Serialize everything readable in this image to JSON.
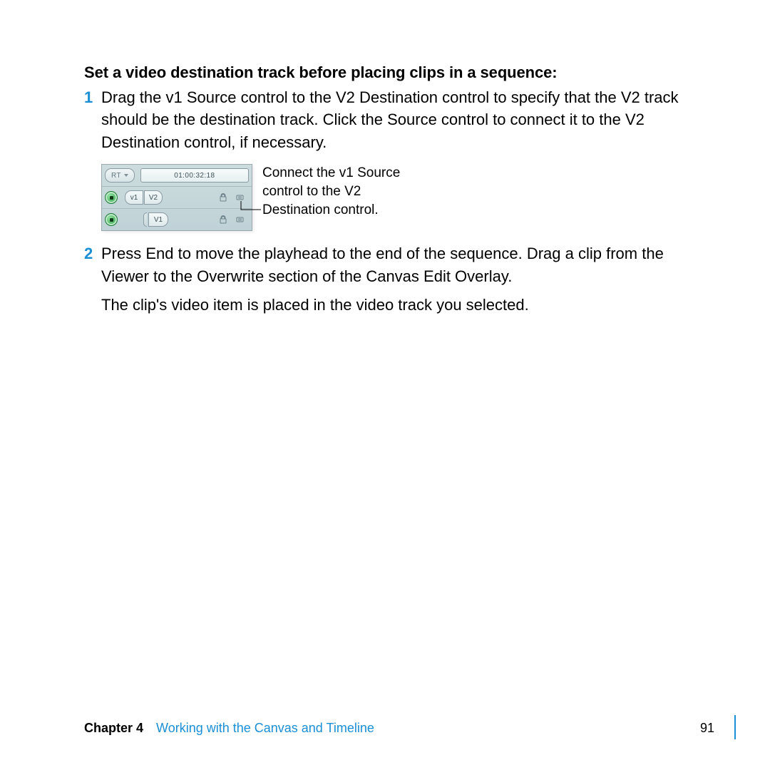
{
  "heading": "Set a video destination track before placing clips in a sequence:",
  "steps": [
    {
      "num": "1",
      "text": "Drag the v1 Source control to the V2 Destination control to specify that the V2 track should be the destination track. Click the Source control to connect it to the V2 Destination control, if necessary."
    },
    {
      "num": "2",
      "text": "Press End to move the playhead to the end of the sequence. Drag a clip from the Viewer to the Overwrite section of the Canvas Edit Overlay."
    }
  ],
  "result_para": "The clip's video item is placed in the video track you selected.",
  "figure": {
    "rt_label": "RT",
    "timecode": "01:00:32:18",
    "source_label": "v1",
    "dest_v2": "V2",
    "dest_v1": "V1",
    "caption_line1": "Connect the v1 Source",
    "caption_line2": "control to the V2",
    "caption_line3": "Destination control."
  },
  "footer": {
    "chapter": "Chapter 4",
    "title": "Working with the Canvas and Timeline",
    "page": "91"
  }
}
